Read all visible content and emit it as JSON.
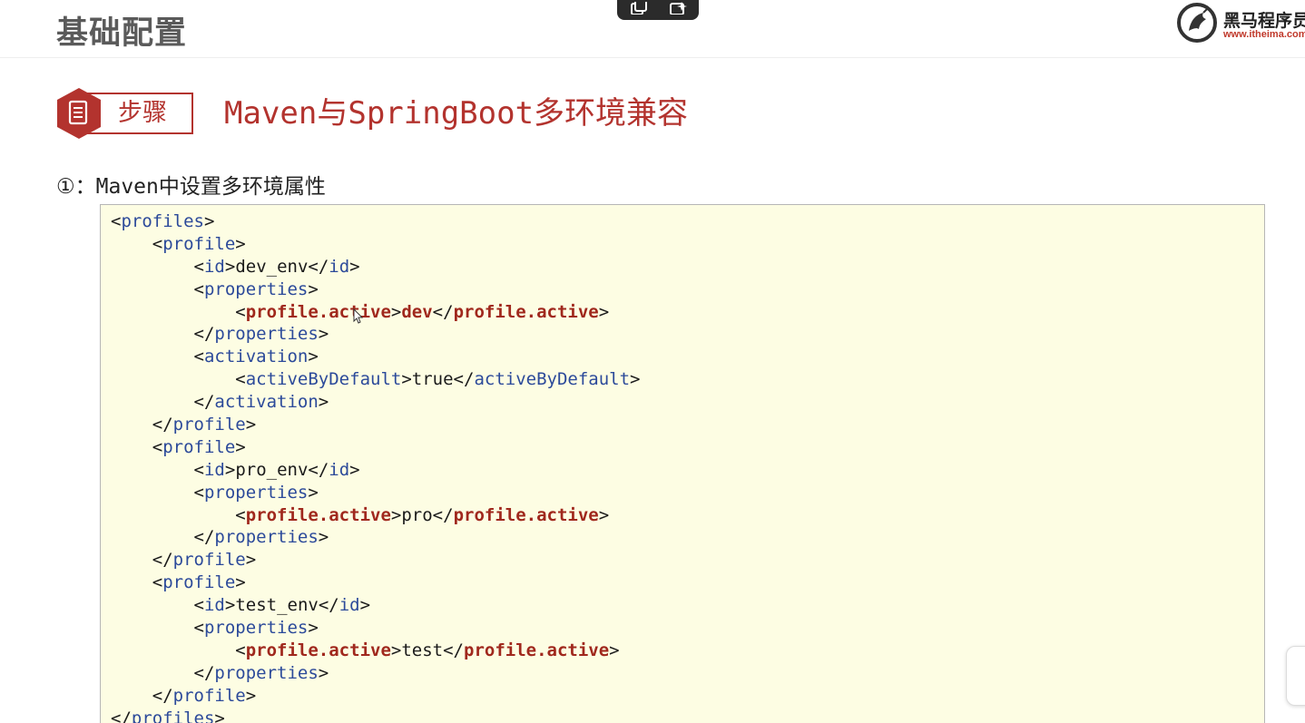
{
  "header": {
    "title": "基础配置",
    "logo_name": "黑马程序员",
    "logo_url": "www.itheima.com"
  },
  "step": {
    "badge_label": "步骤",
    "heading": "Maven与SpringBoot多环境兼容"
  },
  "section": {
    "subheading": "①：Maven中设置多环境属性"
  },
  "code": {
    "lines": [
      {
        "indent": 0,
        "parts": [
          [
            "p",
            "<"
          ],
          [
            "t",
            "profiles"
          ],
          [
            "p",
            ">"
          ]
        ]
      },
      {
        "indent": 1,
        "parts": [
          [
            "p",
            "<"
          ],
          [
            "t",
            "profile"
          ],
          [
            "p",
            ">"
          ]
        ]
      },
      {
        "indent": 2,
        "parts": [
          [
            "p",
            "<"
          ],
          [
            "t",
            "id"
          ],
          [
            "p",
            ">"
          ],
          [
            "x",
            "dev_env"
          ],
          [
            "p",
            "</"
          ],
          [
            "t",
            "id"
          ],
          [
            "p",
            ">"
          ]
        ]
      },
      {
        "indent": 2,
        "parts": [
          [
            "p",
            "<"
          ],
          [
            "t",
            "properties"
          ],
          [
            "p",
            ">"
          ]
        ]
      },
      {
        "indent": 3,
        "parts": [
          [
            "p",
            "<"
          ],
          [
            "h",
            "profile.active"
          ],
          [
            "p",
            ">"
          ],
          [
            "v",
            "dev"
          ],
          [
            "p",
            "</"
          ],
          [
            "h",
            "profile.active"
          ],
          [
            "p",
            ">"
          ]
        ]
      },
      {
        "indent": 2,
        "parts": [
          [
            "p",
            "</"
          ],
          [
            "t",
            "properties"
          ],
          [
            "p",
            ">"
          ]
        ]
      },
      {
        "indent": 2,
        "parts": [
          [
            "p",
            "<"
          ],
          [
            "t",
            "activation"
          ],
          [
            "p",
            ">"
          ]
        ]
      },
      {
        "indent": 3,
        "parts": [
          [
            "p",
            "<"
          ],
          [
            "t",
            "activeByDefault"
          ],
          [
            "p",
            ">"
          ],
          [
            "x",
            "true"
          ],
          [
            "p",
            "</"
          ],
          [
            "t",
            "activeByDefault"
          ],
          [
            "p",
            ">"
          ]
        ]
      },
      {
        "indent": 2,
        "parts": [
          [
            "p",
            "</"
          ],
          [
            "t",
            "activation"
          ],
          [
            "p",
            ">"
          ]
        ]
      },
      {
        "indent": 1,
        "parts": [
          [
            "p",
            "</"
          ],
          [
            "t",
            "profile"
          ],
          [
            "p",
            ">"
          ]
        ]
      },
      {
        "indent": 1,
        "parts": [
          [
            "p",
            "<"
          ],
          [
            "t",
            "profile"
          ],
          [
            "p",
            ">"
          ]
        ]
      },
      {
        "indent": 2,
        "parts": [
          [
            "p",
            "<"
          ],
          [
            "t",
            "id"
          ],
          [
            "p",
            ">"
          ],
          [
            "x",
            "pro_env"
          ],
          [
            "p",
            "</"
          ],
          [
            "t",
            "id"
          ],
          [
            "p",
            ">"
          ]
        ]
      },
      {
        "indent": 2,
        "parts": [
          [
            "p",
            "<"
          ],
          [
            "t",
            "properties"
          ],
          [
            "p",
            ">"
          ]
        ]
      },
      {
        "indent": 3,
        "parts": [
          [
            "p",
            "<"
          ],
          [
            "h",
            "profile.active"
          ],
          [
            "p",
            ">"
          ],
          [
            "x",
            "pro"
          ],
          [
            "p",
            "</"
          ],
          [
            "h",
            "profile.active"
          ],
          [
            "p",
            ">"
          ]
        ]
      },
      {
        "indent": 2,
        "parts": [
          [
            "p",
            "</"
          ],
          [
            "t",
            "properties"
          ],
          [
            "p",
            ">"
          ]
        ]
      },
      {
        "indent": 1,
        "parts": [
          [
            "p",
            "</"
          ],
          [
            "t",
            "profile"
          ],
          [
            "p",
            ">"
          ]
        ]
      },
      {
        "indent": 1,
        "parts": [
          [
            "p",
            "<"
          ],
          [
            "t",
            "profile"
          ],
          [
            "p",
            ">"
          ]
        ]
      },
      {
        "indent": 2,
        "parts": [
          [
            "p",
            "<"
          ],
          [
            "t",
            "id"
          ],
          [
            "p",
            ">"
          ],
          [
            "x",
            "test_env"
          ],
          [
            "p",
            "</"
          ],
          [
            "t",
            "id"
          ],
          [
            "p",
            ">"
          ]
        ]
      },
      {
        "indent": 2,
        "parts": [
          [
            "p",
            "<"
          ],
          [
            "t",
            "properties"
          ],
          [
            "p",
            ">"
          ]
        ]
      },
      {
        "indent": 3,
        "parts": [
          [
            "p",
            "<"
          ],
          [
            "h",
            "profile.active"
          ],
          [
            "p",
            ">"
          ],
          [
            "x",
            "test"
          ],
          [
            "p",
            "</"
          ],
          [
            "h",
            "profile.active"
          ],
          [
            "p",
            ">"
          ]
        ]
      },
      {
        "indent": 2,
        "parts": [
          [
            "p",
            "</"
          ],
          [
            "t",
            "properties"
          ],
          [
            "p",
            ">"
          ]
        ]
      },
      {
        "indent": 1,
        "parts": [
          [
            "p",
            "</"
          ],
          [
            "t",
            "profile"
          ],
          [
            "p",
            ">"
          ]
        ]
      },
      {
        "indent": 0,
        "parts": [
          [
            "p",
            "</"
          ],
          [
            "t",
            "profiles"
          ],
          [
            "p",
            ">"
          ]
        ]
      }
    ]
  },
  "colors": {
    "accent": "#b3332e",
    "tag": "#2c4a9a",
    "highlight": "#a0281d",
    "code_bg": "#fdfde3"
  },
  "icons": {
    "step": "document-icon",
    "toolbar": [
      "copy-icon",
      "magic-edit-icon"
    ],
    "logo": "horse-logo-icon"
  }
}
